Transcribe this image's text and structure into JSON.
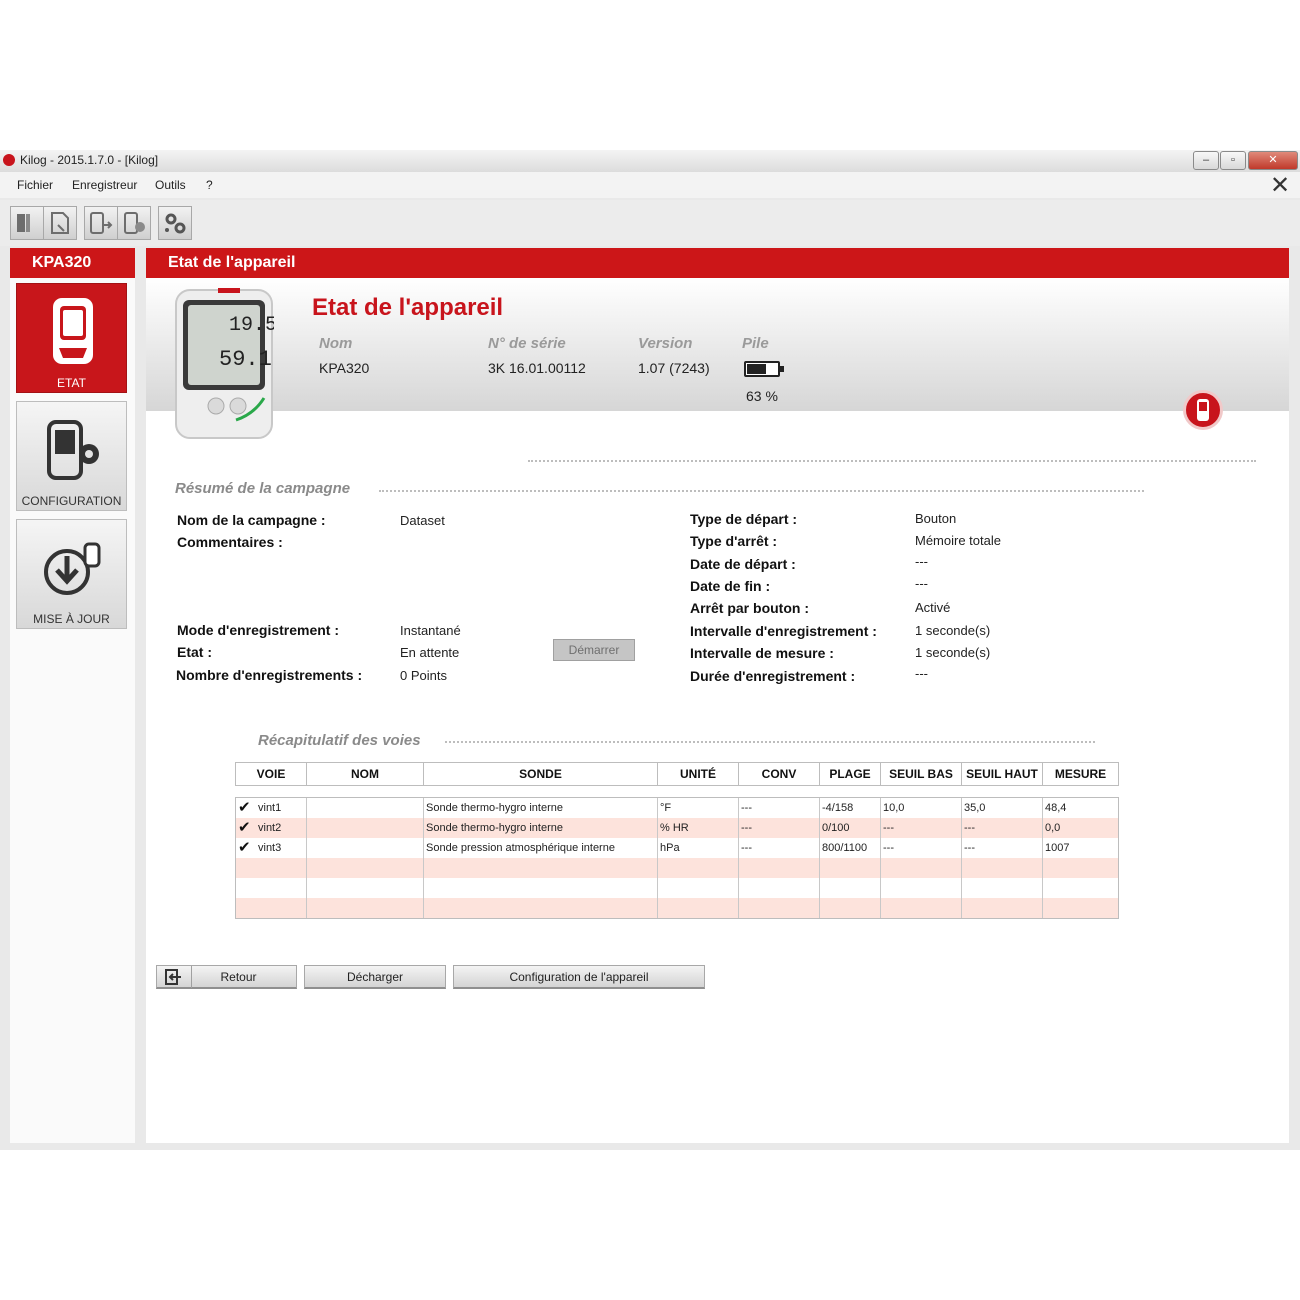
{
  "window": {
    "title": "Kilog - 2015.1.7.0 - [Kilog]",
    "controls": [
      "minimize",
      "maximize",
      "close"
    ]
  },
  "menu": [
    "Fichier",
    "Enregistreur",
    "Outils",
    "?"
  ],
  "sidebar": {
    "device": "KPA320",
    "items": [
      {
        "label": "ETAT",
        "icon": "device-icon",
        "active": true
      },
      {
        "label": "CONFIGURATION",
        "icon": "device-gear-icon",
        "active": false
      },
      {
        "label": "MISE À JOUR",
        "icon": "download-icon",
        "active": false
      }
    ]
  },
  "main": {
    "header": "Etat de l'appareil",
    "band_title": "Etat de l'appareil",
    "device_display": {
      "top": "19.5",
      "bottom": "59.1"
    },
    "info": {
      "nom_label": "Nom",
      "nom": "KPA320",
      "serie_label": "N° de série",
      "serie": "3K 16.01.00112",
      "version_label": "Version",
      "version": "1.07 (7243)",
      "pile_label": "Pile",
      "pile": "63 %",
      "pile_level": 0.63
    }
  },
  "campaign": {
    "title": "Résumé de la campagne",
    "left": [
      {
        "label": "Nom de la campagne :",
        "value": "Dataset"
      },
      {
        "label": "Commentaires :",
        "value": ""
      },
      {
        "label": "Mode d'enregistrement :",
        "value": "Instantané"
      },
      {
        "label": "Etat :",
        "value": "En attente"
      },
      {
        "label": "Nombre d'enregistrements :",
        "value": "0 Points"
      }
    ],
    "start_button": "Démarrer",
    "right": [
      {
        "label": "Type de départ :",
        "value": "Bouton"
      },
      {
        "label": "Type d'arrêt :",
        "value": "Mémoire totale"
      },
      {
        "label": "Date de départ :",
        "value": "---"
      },
      {
        "label": "Date de fin :",
        "value": "---"
      },
      {
        "label": "Arrêt par bouton :",
        "value": "Activé"
      },
      {
        "label": "Intervalle d'enregistrement :",
        "value": "1 seconde(s)"
      },
      {
        "label": "Intervalle de mesure :",
        "value": "1 seconde(s)"
      },
      {
        "label": "Durée d'enregistrement :",
        "value": "---"
      }
    ]
  },
  "channels": {
    "title": "Récapitulatif des voies",
    "columns": [
      "VOIE",
      "NOM",
      "SONDE",
      "UNITÉ",
      "CONV",
      "PLAGE",
      "SEUIL BAS",
      "SEUIL HAUT",
      "MESURE"
    ],
    "rows": [
      [
        "vint1",
        "",
        "Sonde thermo-hygro interne",
        "°F",
        "---",
        "-4/158",
        "10,0",
        "35,0",
        "48,4"
      ],
      [
        "vint2",
        "",
        "Sonde thermo-hygro interne",
        "% HR",
        "---",
        "0/100",
        "---",
        "---",
        "0,0"
      ],
      [
        "vint3",
        "",
        "Sonde pression atmosphérique interne",
        "hPa",
        "---",
        "800/1100",
        "---",
        "---",
        "1007"
      ]
    ],
    "empty_rows": 3
  },
  "buttons": {
    "retour": "Retour",
    "decharger": "Décharger",
    "config": "Configuration de l'appareil"
  },
  "colors": {
    "accent": "#cc1618",
    "row_alt": "#fde3dc"
  }
}
